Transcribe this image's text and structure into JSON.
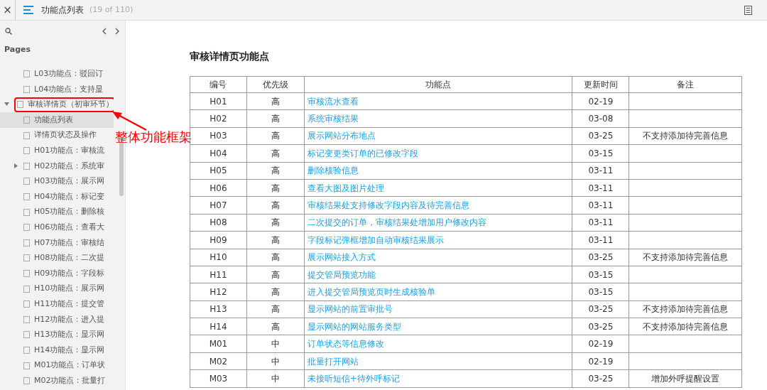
{
  "topbar": {
    "close": "×",
    "title": "功能点列表",
    "count": "(19 of 110)"
  },
  "sidebar": {
    "heading": "Pages",
    "tree": [
      {
        "kind": "offscreen-parent",
        "children": [
          {
            "label": "L03功能点：驳回订",
            "kind": "leaf",
            "selected": false
          },
          {
            "label": "L04功能点：支持显",
            "kind": "leaf",
            "selected": false
          }
        ]
      },
      {
        "label": "审核详情页（初审环节）",
        "kind": "folder",
        "expanded": true,
        "selected": false,
        "highlighted": true,
        "children": [
          {
            "label": "功能点列表",
            "kind": "leaf",
            "selected": true
          },
          {
            "label": "详情页状态及操作",
            "kind": "leaf",
            "selected": false
          },
          {
            "label": "H01功能点：审核流",
            "kind": "leaf",
            "selected": false
          },
          {
            "label": "H02功能点：系统审",
            "kind": "folder",
            "expanded": false,
            "selected": false
          },
          {
            "label": "H03功能点：展示网",
            "kind": "leaf",
            "selected": false
          },
          {
            "label": "H04功能点：标记变",
            "kind": "leaf",
            "selected": false
          },
          {
            "label": "H05功能点：删除核",
            "kind": "leaf",
            "selected": false
          },
          {
            "label": "H06功能点：查看大",
            "kind": "leaf",
            "selected": false
          },
          {
            "label": "H07功能点：审核结",
            "kind": "leaf",
            "selected": false
          },
          {
            "label": "H08功能点：二次提",
            "kind": "leaf",
            "selected": false
          },
          {
            "label": "H09功能点：字段标",
            "kind": "leaf",
            "selected": false
          },
          {
            "label": "H10功能点：展示网",
            "kind": "leaf",
            "selected": false
          },
          {
            "label": "H11功能点：提交管",
            "kind": "leaf",
            "selected": false
          },
          {
            "label": "H12功能点：进入提",
            "kind": "leaf",
            "selected": false
          },
          {
            "label": "H13功能点：显示网",
            "kind": "leaf",
            "selected": false
          },
          {
            "label": "H14功能点：显示网",
            "kind": "leaf",
            "selected": false
          },
          {
            "label": "M01功能点：订单状",
            "kind": "leaf",
            "selected": false
          },
          {
            "label": "M02功能点：批量打",
            "kind": "leaf",
            "selected": false
          }
        ]
      }
    ]
  },
  "content": {
    "heading": "审核详情页功能点",
    "table": {
      "columns": [
        "编号",
        "优先级",
        "功能点",
        "更新时间",
        "备注"
      ],
      "rows": [
        [
          "H01",
          "高",
          "审核流水查看",
          "02-19",
          ""
        ],
        [
          "H02",
          "高",
          "系统审核结果",
          "03-08",
          ""
        ],
        [
          "H03",
          "高",
          "展示网站分布地点",
          "03-25",
          "不支持添加待完善信息"
        ],
        [
          "H04",
          "高",
          "标记变更类订单的已修改字段",
          "03-15",
          ""
        ],
        [
          "H05",
          "高",
          "删除核验信息",
          "03-11",
          ""
        ],
        [
          "H06",
          "高",
          "查看大图及图片处理",
          "03-11",
          ""
        ],
        [
          "H07",
          "高",
          "审核结果处支持修改字段内容及待完善信息",
          "03-11",
          ""
        ],
        [
          "H08",
          "高",
          "二次提交的订单，审核结果处增加用户修改内容",
          "03-11",
          ""
        ],
        [
          "H09",
          "高",
          "字段标记弹框增加自动审核结果展示",
          "03-11",
          ""
        ],
        [
          "H10",
          "高",
          "展示网站接入方式",
          "03-25",
          "不支持添加待完善信息"
        ],
        [
          "H11",
          "高",
          "提交管局预览功能",
          "03-15",
          ""
        ],
        [
          "H12",
          "高",
          "进入提交管局预览页时生成核验单",
          "03-15",
          ""
        ],
        [
          "H13",
          "高",
          "显示网站的前置审批号",
          "03-25",
          "不支持添加待完善信息"
        ],
        [
          "H14",
          "高",
          "显示网站的网站服务类型",
          "03-25",
          "不支持添加待完善信息"
        ],
        [
          "M01",
          "中",
          "订单状态等信息修改",
          "02-19",
          ""
        ],
        [
          "M02",
          "中",
          "批量打开网站",
          "02-19",
          ""
        ],
        [
          "M03",
          "中",
          "未接听短信+待外呼标记",
          "03-25",
          "增加外呼提醒设置"
        ]
      ]
    }
  },
  "annotation": {
    "label": "整体功能框架"
  }
}
